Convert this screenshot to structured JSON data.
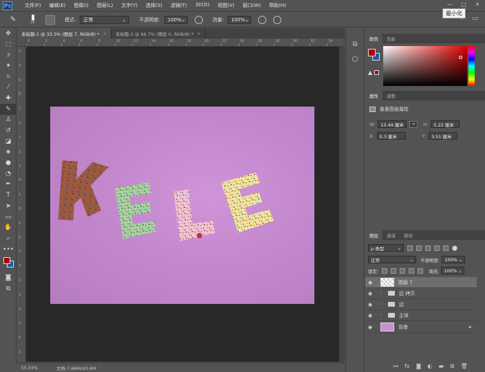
{
  "app": {
    "logo": "Ps"
  },
  "menu": [
    "文件(F)",
    "编辑(E)",
    "图像(I)",
    "图层(L)",
    "文字(Y)",
    "选择(S)",
    "滤镜(T)",
    "3D(D)",
    "视图(V)",
    "窗口(W)",
    "帮助(H)"
  ],
  "window": {
    "tooltip": "最小化"
  },
  "options": {
    "brush_size": "18",
    "mode_label": "模式:",
    "mode_value": "正常",
    "opacity_label": "不透明度:",
    "opacity_value": "100%",
    "flow_label": "流量:",
    "flow_value": "100%"
  },
  "tabs": [
    {
      "label": "未标题-1 @ 33.3% (图层 7, RGB/8) *",
      "close": "×"
    },
    {
      "label": "未标题-2 @ 66.7% (图层 0, RGB/8) *",
      "close": "×"
    }
  ],
  "ruler": {
    "h": [
      "0",
      "2",
      "4",
      "6",
      "8",
      "10",
      "12",
      "14",
      "16",
      "18",
      "20",
      "22",
      "24",
      "26",
      "28",
      "30",
      "32",
      "34"
    ],
    "v": [
      "2",
      "4",
      "6",
      "8",
      "1",
      "1",
      "1",
      "2",
      "1",
      "4",
      "1",
      "6",
      "1",
      "8",
      "2",
      "2",
      "2",
      "2",
      "4",
      "2",
      "6",
      "2"
    ]
  },
  "status": {
    "zoom": "33.33%",
    "doc": "文档:7.66M/43.6M",
    "arrow": "›"
  },
  "colors": {
    "foreground": "#b30000",
    "background": "#1a5aaa",
    "artwork_bg": "#c48ace"
  },
  "color_panel": {
    "tabs": [
      "颜色",
      "色板"
    ]
  },
  "properties": {
    "tabs": [
      "属性",
      "调整"
    ],
    "title": "像素图层属性",
    "w_label": "W:",
    "w_value": "13.49 厘米",
    "h_label": "H:",
    "h_value": "5.22 厘米",
    "x_label": "X:",
    "x_value": "0.3 厘米",
    "y_label": "Y:",
    "y_value": "3.51 厘米"
  },
  "layers": {
    "tabs": [
      "图层",
      "通道",
      "路径"
    ],
    "filter_value": "ρ 类型",
    "blend_value": "正常",
    "opacity_label": "不透明度:",
    "opacity_value": "100%",
    "lock_label": "锁定:",
    "fill_label": "填充:",
    "fill_value": "100%",
    "items": [
      {
        "name": "图层 7",
        "type": "layer"
      },
      {
        "name": "边 拷贝",
        "type": "group"
      },
      {
        "name": "边",
        "type": "group"
      },
      {
        "name": "主体",
        "type": "group"
      },
      {
        "name": "背景",
        "type": "background"
      }
    ],
    "footer_icons": [
      "link-icon",
      "fx-icon",
      "mask-icon",
      "adjustment-icon",
      "folder-icon",
      "new-layer-icon",
      "trash-icon"
    ]
  }
}
